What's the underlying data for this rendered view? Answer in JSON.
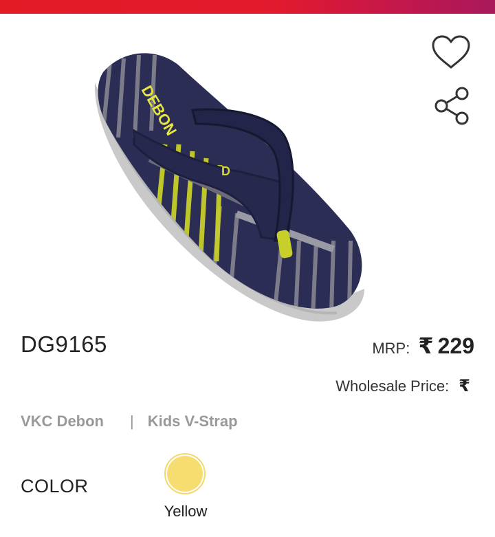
{
  "header": {
    "accent": "#e31b25"
  },
  "product": {
    "image_alt": "DEBON flip flop",
    "sku": "DG9165",
    "mrp_label": "MRP:",
    "currency": "₹",
    "mrp_value": "229",
    "wholesale_label": "Wholesale Price:",
    "brand": "VKC Debon",
    "separator": "|",
    "category": "Kids V-Strap",
    "color_label": "COLOR",
    "colors": [
      {
        "name": "Yellow",
        "hex": "#f7dc6f"
      }
    ]
  },
  "actions": {
    "wishlist_icon": "heart-icon",
    "share_icon": "share-icon"
  }
}
